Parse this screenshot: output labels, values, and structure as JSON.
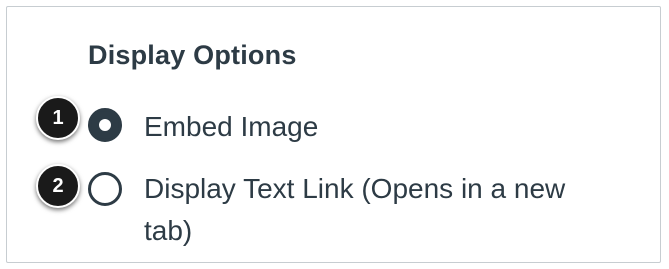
{
  "display_options": {
    "heading": "Display Options",
    "options": [
      {
        "label": "Embed Image",
        "checked": true
      },
      {
        "label": "Display Text Link (Opens in a new tab)",
        "checked": false
      }
    ]
  },
  "callouts": [
    "1",
    "2"
  ],
  "colors": {
    "text": "#2d3b45",
    "border": "#c7cdd1",
    "callout_bg": "#1a1a1a"
  }
}
